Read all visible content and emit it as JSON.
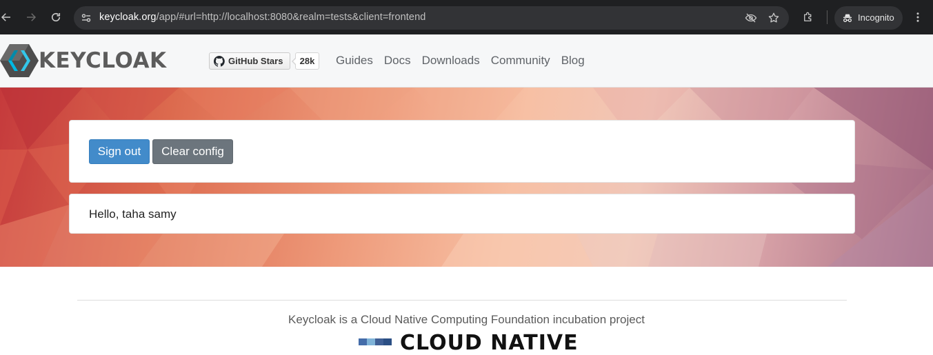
{
  "browser": {
    "url_host": "keycloak.org",
    "url_rest": "/app/#url=http://localhost:8080&realm=tests&client=frontend",
    "incognito_label": "Incognito"
  },
  "header": {
    "logo_text": "KEYCLOAK",
    "github_stars_label": "GitHub Stars",
    "github_stars_count": "28k",
    "nav": [
      "Guides",
      "Docs",
      "Downloads",
      "Community",
      "Blog"
    ]
  },
  "main": {
    "sign_out_label": "Sign out",
    "clear_config_label": "Clear config",
    "greeting": "Hello, taha samy"
  },
  "footer": {
    "text": "Keycloak is a Cloud Native Computing Foundation incubation project",
    "cncf_text": "CLOUD NATIVE"
  },
  "colors": {
    "primary_button": "#428bca",
    "secondary_button": "#6c757d",
    "browser_chrome": "#1f2022"
  }
}
